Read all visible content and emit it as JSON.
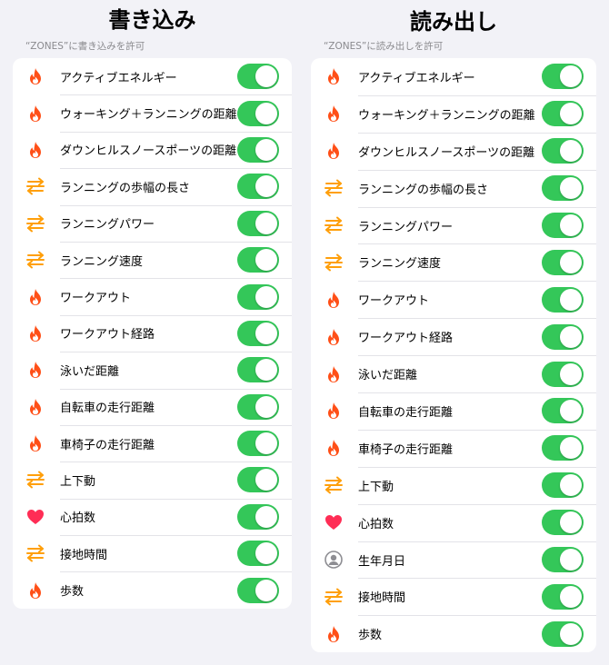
{
  "colors": {
    "background": "#f2f2f7",
    "toggle_on": "#34c759",
    "flame": "#ff4f17",
    "arrows": "#ff9f0a",
    "heart": "#ff2d55",
    "person": "#8e8e93"
  },
  "write": {
    "title": "書き込み",
    "subtitle": "“ZONES”に書き込みを許可",
    "items": [
      {
        "label": "アクティブエネルギー",
        "icon": "flame-icon",
        "enabled": true
      },
      {
        "label": "ウォーキング＋ランニングの距離",
        "icon": "flame-icon",
        "enabled": true
      },
      {
        "label": "ダウンヒルスノースポーツの距離",
        "icon": "flame-icon",
        "enabled": true
      },
      {
        "label": "ランニングの歩幅の長さ",
        "icon": "arrows-icon",
        "enabled": true
      },
      {
        "label": "ランニングパワー",
        "icon": "arrows-icon",
        "enabled": true
      },
      {
        "label": "ランニング速度",
        "icon": "arrows-icon",
        "enabled": true
      },
      {
        "label": "ワークアウト",
        "icon": "flame-icon",
        "enabled": true
      },
      {
        "label": "ワークアウト経路",
        "icon": "flame-icon",
        "enabled": true
      },
      {
        "label": "泳いだ距離",
        "icon": "flame-icon",
        "enabled": true
      },
      {
        "label": "自転車の走行距離",
        "icon": "flame-icon",
        "enabled": true
      },
      {
        "label": "車椅子の走行距離",
        "icon": "flame-icon",
        "enabled": true
      },
      {
        "label": "上下動",
        "icon": "arrows-icon",
        "enabled": true
      },
      {
        "label": "心拍数",
        "icon": "heart-icon",
        "enabled": true
      },
      {
        "label": "接地時間",
        "icon": "arrows-icon",
        "enabled": true
      },
      {
        "label": "歩数",
        "icon": "flame-icon",
        "enabled": true
      }
    ]
  },
  "read": {
    "title": "読み出し",
    "subtitle": "“ZONES”に読み出しを許可",
    "items": [
      {
        "label": "アクティブエネルギー",
        "icon": "flame-icon",
        "enabled": true
      },
      {
        "label": "ウォーキング＋ランニングの距離",
        "icon": "flame-icon",
        "enabled": true
      },
      {
        "label": "ダウンヒルスノースポーツの距離",
        "icon": "flame-icon",
        "enabled": true
      },
      {
        "label": "ランニングの歩幅の長さ",
        "icon": "arrows-icon",
        "enabled": true
      },
      {
        "label": "ランニングパワー",
        "icon": "arrows-icon",
        "enabled": true
      },
      {
        "label": "ランニング速度",
        "icon": "arrows-icon",
        "enabled": true
      },
      {
        "label": "ワークアウト",
        "icon": "flame-icon",
        "enabled": true
      },
      {
        "label": "ワークアウト経路",
        "icon": "flame-icon",
        "enabled": true
      },
      {
        "label": "泳いだ距離",
        "icon": "flame-icon",
        "enabled": true
      },
      {
        "label": "自転車の走行距離",
        "icon": "flame-icon",
        "enabled": true
      },
      {
        "label": "車椅子の走行距離",
        "icon": "flame-icon",
        "enabled": true
      },
      {
        "label": "上下動",
        "icon": "arrows-icon",
        "enabled": true
      },
      {
        "label": "心拍数",
        "icon": "heart-icon",
        "enabled": true
      },
      {
        "label": "生年月日",
        "icon": "person-icon",
        "enabled": true
      },
      {
        "label": "接地時間",
        "icon": "arrows-icon",
        "enabled": true
      },
      {
        "label": "歩数",
        "icon": "flame-icon",
        "enabled": true
      }
    ]
  }
}
